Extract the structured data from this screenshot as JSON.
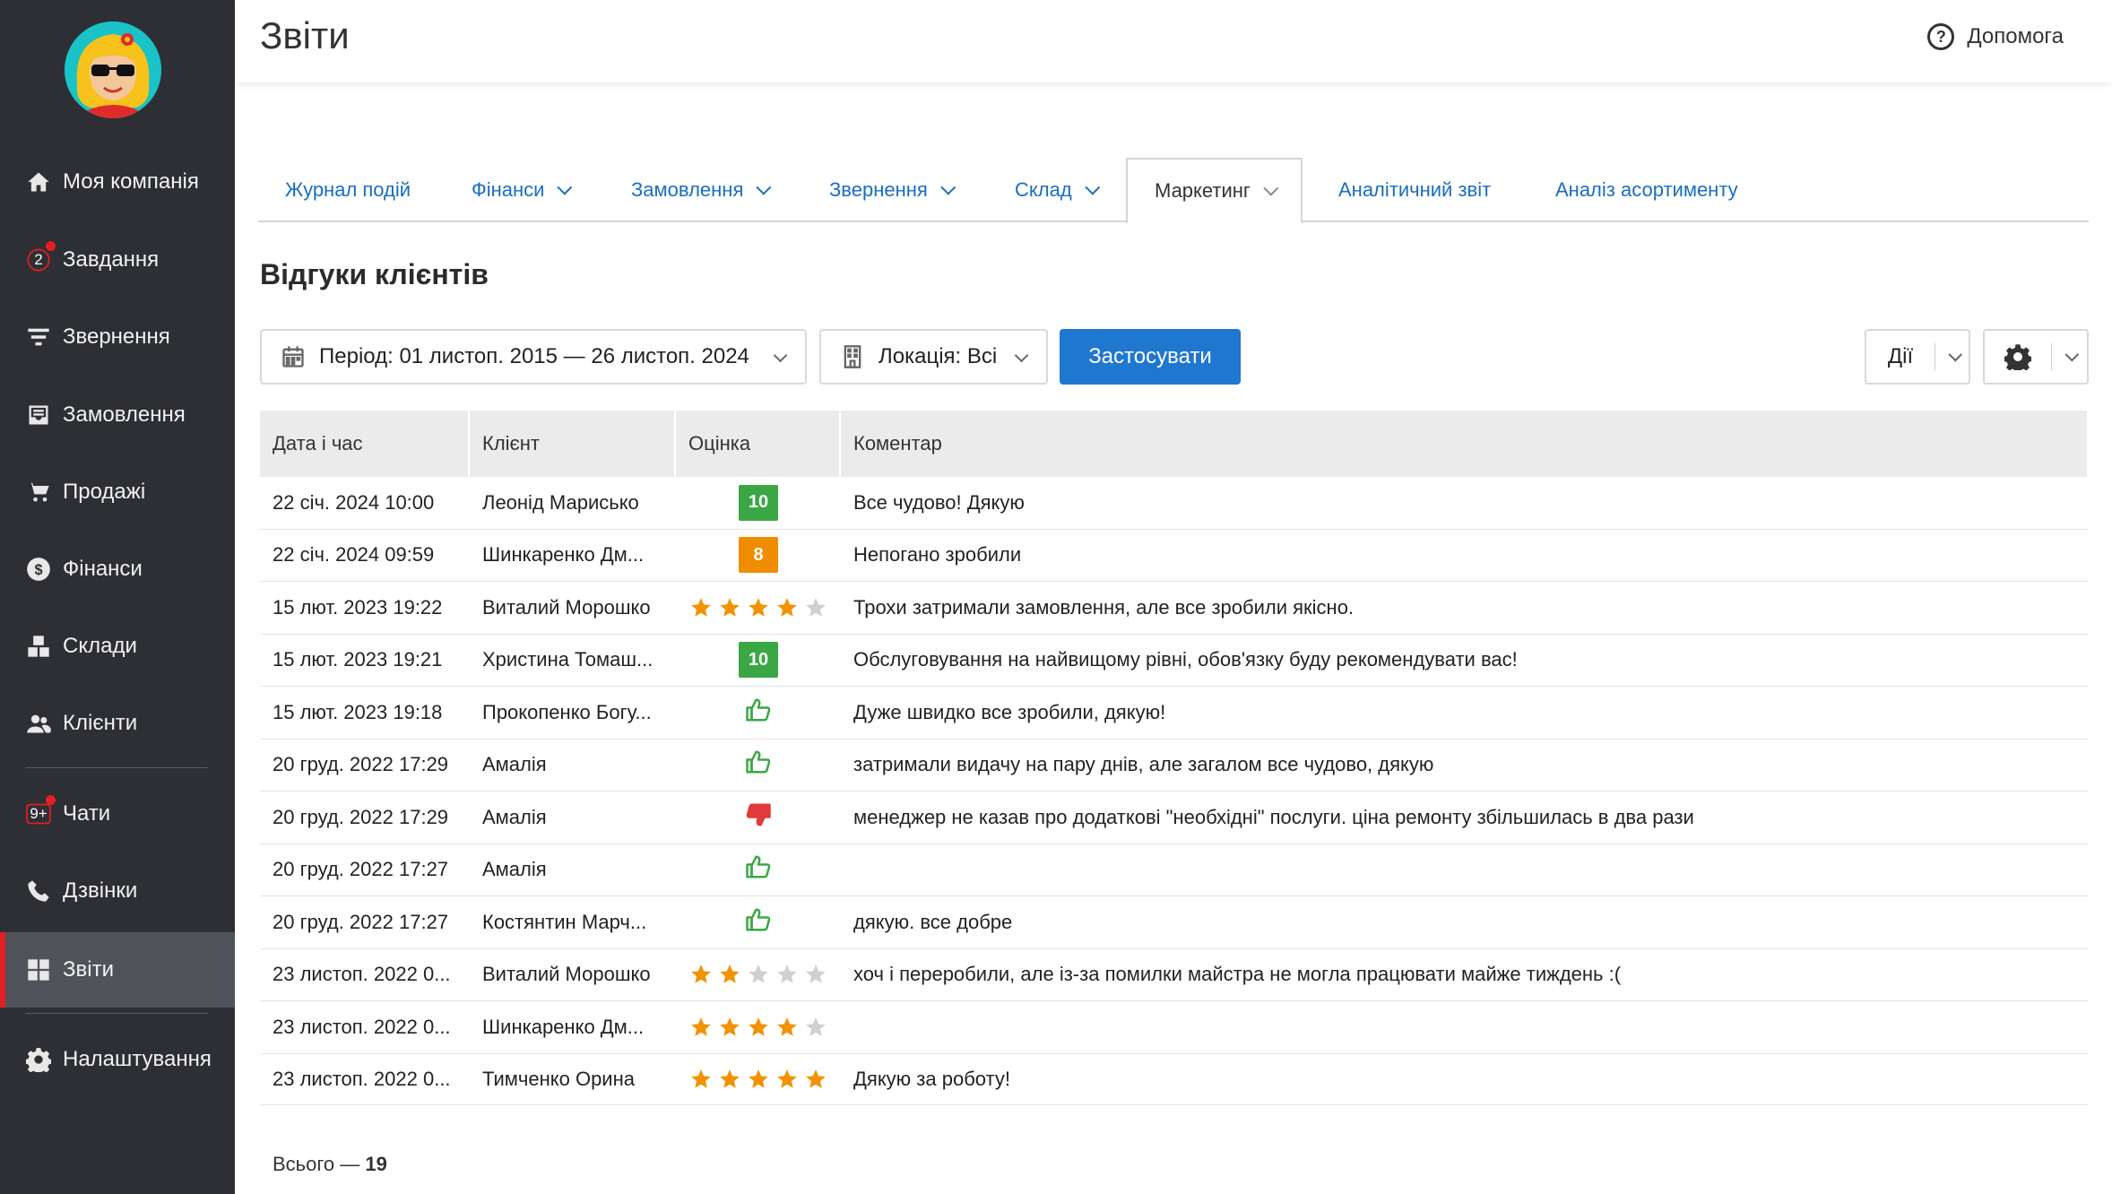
{
  "sidebar": {
    "items": [
      {
        "label": "Моя компанія",
        "icon": "home-icon"
      },
      {
        "label": "Завдання",
        "icon": "tasks-icon",
        "badge": "2"
      },
      {
        "label": "Звернення",
        "icon": "filter-lines-icon"
      },
      {
        "label": "Замовлення",
        "icon": "inbox-icon"
      },
      {
        "label": "Продажі",
        "icon": "cart-icon"
      },
      {
        "label": "Фінанси",
        "icon": "dollar-icon"
      },
      {
        "label": "Склади",
        "icon": "boxes-icon"
      },
      {
        "label": "Клієнти",
        "icon": "users-icon"
      },
      {
        "label": "Чати",
        "icon": "chat-icon",
        "badge": "9+"
      },
      {
        "label": "Дзвінки",
        "icon": "phone-icon"
      },
      {
        "label": "Звіти",
        "icon": "grid-icon",
        "active": true
      },
      {
        "label": "Налаштування",
        "icon": "gear-icon"
      }
    ]
  },
  "header": {
    "title": "Звіти",
    "help_label": "Допомога"
  },
  "tabs": [
    {
      "label": "Журнал подій"
    },
    {
      "label": "Фінанси"
    },
    {
      "label": "Замовлення"
    },
    {
      "label": "Звернення"
    },
    {
      "label": "Склад"
    },
    {
      "label": "Маркетинг",
      "active": true
    },
    {
      "label": "Аналітичний звіт"
    },
    {
      "label": "Аналіз асортименту"
    }
  ],
  "section_title": "Відгуки клієнтів",
  "filters": {
    "period": "Період: 01 листоп. 2015 — 26 листоп. 2024",
    "location": "Локація: Всі",
    "apply": "Застосувати",
    "actions": "Дії"
  },
  "table": {
    "headers": [
      "Дата і час",
      "Клієнт",
      "Оцінка",
      "Коментар"
    ],
    "rows": [
      {
        "date": "22 січ. 2024 10:00",
        "client": "Леонід Марисько",
        "rating_type": "score",
        "rating": "10",
        "comment": "Все чудово! Дякую"
      },
      {
        "date": "22 січ. 2024 09:59",
        "client": "Шинкаренко Дм...",
        "rating_type": "score",
        "rating": "8",
        "comment": "Непогано зробили"
      },
      {
        "date": "15 лют. 2023 19:22",
        "client": "Виталий Морошко",
        "rating_type": "stars",
        "rating": 4,
        "comment": "Трохи затримали замовлення, але все зробили якісно."
      },
      {
        "date": "15 лют. 2023 19:21",
        "client": "Христина Томаш...",
        "rating_type": "score",
        "rating": "10",
        "comment": "Обслуговування на найвищому рівні, обов'язку буду рекомендувати вас!"
      },
      {
        "date": "15 лют. 2023 19:18",
        "client": "Прокопенко Богу...",
        "rating_type": "thumb",
        "rating": "up",
        "comment": "Дуже швидко все зробили, дякую!"
      },
      {
        "date": "20 груд. 2022 17:29",
        "client": "Амалія",
        "rating_type": "thumb",
        "rating": "up",
        "comment": "затримали видачу на пару днів, але загалом все чудово, дякую"
      },
      {
        "date": "20 груд. 2022 17:29",
        "client": "Амалія",
        "rating_type": "thumb",
        "rating": "down",
        "comment": "менеджер не казав про додаткові \"необхідні\" послуги. ціна ремонту збільшилась в два рази"
      },
      {
        "date": "20 груд. 2022 17:27",
        "client": "Амалія",
        "rating_type": "thumb",
        "rating": "up",
        "comment": ""
      },
      {
        "date": "20 груд. 2022 17:27",
        "client": "Костянтин Марч...",
        "rating_type": "thumb",
        "rating": "up",
        "comment": "дякую. все добре"
      },
      {
        "date": "23 листоп. 2022 0...",
        "client": "Виталий Морошко",
        "rating_type": "stars",
        "rating": 2,
        "comment": "хоч і переробили, але із-за помилки майстра не могла працювати майже тиждень :("
      },
      {
        "date": "23 листоп. 2022 0...",
        "client": "Шинкаренко Дм...",
        "rating_type": "stars",
        "rating": 4,
        "comment": ""
      },
      {
        "date": "23 листоп. 2022 0...",
        "client": "Тимченко Орина",
        "rating_type": "stars",
        "rating": 5,
        "comment": "Дякую за роботу!"
      }
    ]
  },
  "total_label": "Всього —",
  "total_count": "19",
  "colors": {
    "sidebar_bg": "#2d2f34",
    "accent_blue": "#2077d0",
    "active_red": "#e31e24",
    "score_green": "#3aa744",
    "score_orange": "#f08c00",
    "star_orange": "#f39200",
    "thumb_up": "#3aa744",
    "thumb_down": "#e03a3a"
  }
}
